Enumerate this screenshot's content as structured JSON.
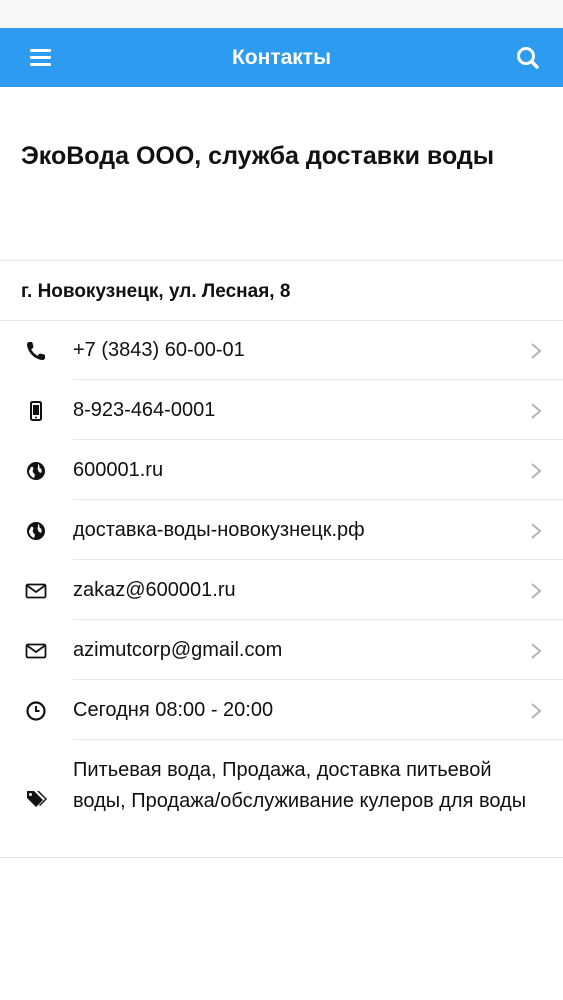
{
  "header": {
    "title": "Контакты",
    "accent_color": "#2d9bef",
    "menu_icon": "hamburger-menu-icon",
    "search_icon": "search-icon"
  },
  "company": {
    "name": "ЭкоВода ООО, служба доставки воды",
    "address": "г. Новокузнецк, ул. Лесная, 8"
  },
  "contacts": [
    {
      "icon": "phone-icon",
      "text": "+7 (3843) 60-00-01"
    },
    {
      "icon": "mobile-phone-icon",
      "text": "8-923-464-0001"
    },
    {
      "icon": "globe-icon",
      "text": "600001.ru"
    },
    {
      "icon": "globe-icon",
      "text": "доставка-воды-новокузнецк.рф"
    },
    {
      "icon": "envelope-icon",
      "text": "zakaz@600001.ru"
    },
    {
      "icon": "envelope-icon",
      "text": "azimutcorp@gmail.com"
    },
    {
      "icon": "clock-icon",
      "text": "Сегодня 08:00 - 20:00"
    }
  ],
  "tags": {
    "icon": "tags-icon",
    "text": "Питьевая вода, Продажа, доставка питьевой воды, Продажа/обслуживание кулеров для воды"
  }
}
